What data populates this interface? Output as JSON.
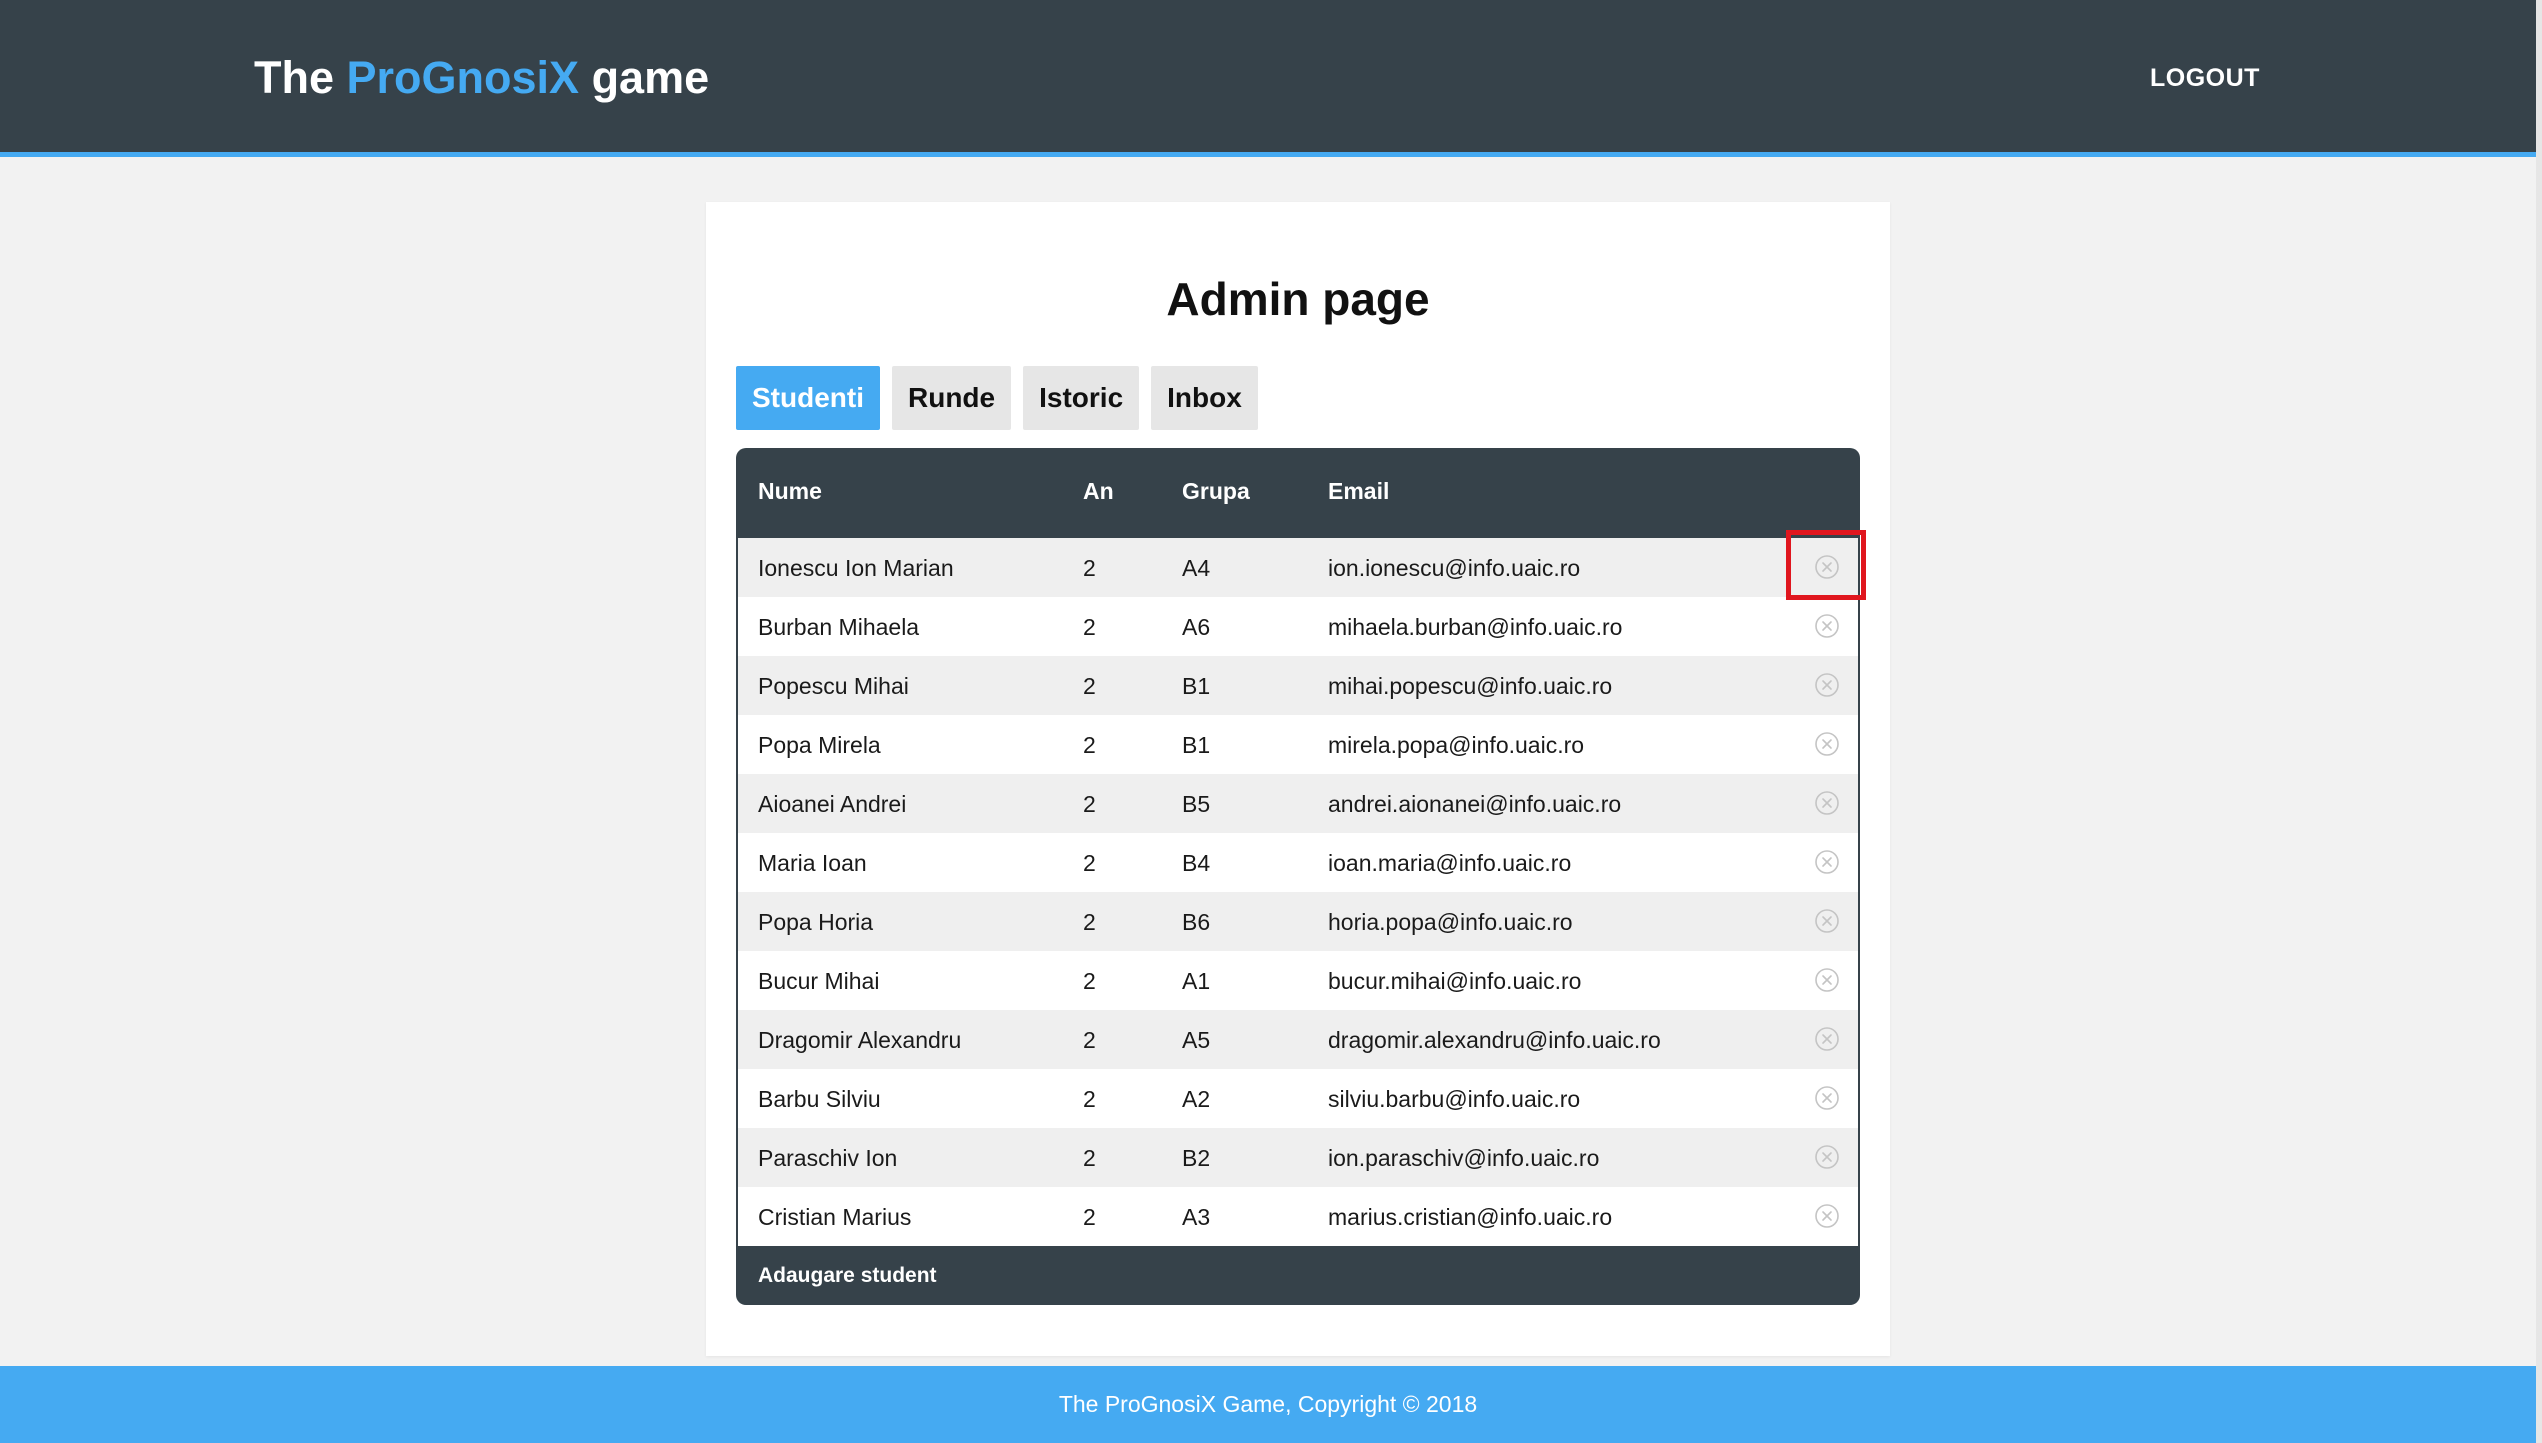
{
  "header": {
    "brand_prefix": "The ",
    "brand_accent": "ProGnosiX",
    "brand_suffix": " game",
    "logout_label": "LOGOUT"
  },
  "main": {
    "title": "Admin page",
    "tabs": [
      {
        "label": "Studenti",
        "active": true
      },
      {
        "label": "Runde",
        "active": false
      },
      {
        "label": "Istoric",
        "active": false
      },
      {
        "label": "Inbox",
        "active": false
      }
    ],
    "table": {
      "columns": [
        "Nume",
        "An",
        "Grupa",
        "Email"
      ],
      "rows": [
        {
          "name": "Ionescu Ion Marian",
          "an": "2",
          "grupa": "A4",
          "email": "ion.ionescu@info.uaic.ro"
        },
        {
          "name": "Burban Mihaela",
          "an": "2",
          "grupa": "A6",
          "email": "mihaela.burban@info.uaic.ro"
        },
        {
          "name": "Popescu Mihai",
          "an": "2",
          "grupa": "B1",
          "email": "mihai.popescu@info.uaic.ro"
        },
        {
          "name": "Popa Mirela",
          "an": "2",
          "grupa": "B1",
          "email": "mirela.popa@info.uaic.ro"
        },
        {
          "name": "Aioanei Andrei",
          "an": "2",
          "grupa": "B5",
          "email": "andrei.aionanei@info.uaic.ro"
        },
        {
          "name": "Maria Ioan",
          "an": "2",
          "grupa": "B4",
          "email": "ioan.maria@info.uaic.ro"
        },
        {
          "name": "Popa Horia",
          "an": "2",
          "grupa": "B6",
          "email": "horia.popa@info.uaic.ro"
        },
        {
          "name": "Bucur Mihai",
          "an": "2",
          "grupa": "A1",
          "email": "bucur.mihai@info.uaic.ro"
        },
        {
          "name": "Dragomir Alexandru",
          "an": "2",
          "grupa": "A5",
          "email": "dragomir.alexandru@info.uaic.ro"
        },
        {
          "name": "Barbu Silviu",
          "an": "2",
          "grupa": "A2",
          "email": "silviu.barbu@info.uaic.ro"
        },
        {
          "name": "Paraschiv Ion",
          "an": "2",
          "grupa": "B2",
          "email": "ion.paraschiv@info.uaic.ro"
        },
        {
          "name": "Cristian Marius",
          "an": "2",
          "grupa": "A3",
          "email": "marius.cristian@info.uaic.ro"
        }
      ],
      "delete_icon": "close-circle-icon",
      "footer_label": "Adaugare student"
    }
  },
  "footer": {
    "text": "The ProGnosiX Game, Copyright © 2018"
  },
  "colors": {
    "header_bg": "#36424a",
    "accent": "#45aaf2",
    "highlight": "#e0161e"
  }
}
